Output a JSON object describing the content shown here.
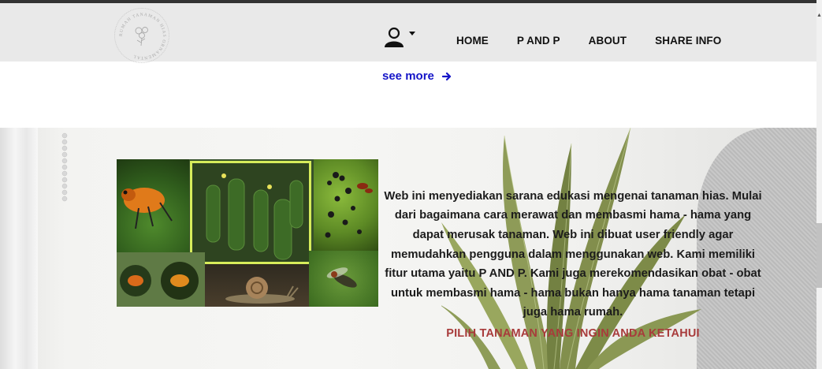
{
  "header": {
    "logo_text": "RUMAH TANAMAN HIAS ORNAMENTAL",
    "nav": [
      {
        "label": "HOME"
      },
      {
        "label": "P AND P"
      },
      {
        "label": "ABOUT"
      },
      {
        "label": "SHARE INFO"
      }
    ],
    "user_icon": "user-icon",
    "dropdown_icon": "caret-down-icon"
  },
  "see_more": {
    "label": "see more",
    "icon": "arrow-right-icon"
  },
  "about": {
    "description": "Web ini menyediakan sarana edukasi mengenai tanaman hias. Mulai dari bagaimana cara merawat dan membasmi hama - hama yang dapat merusak tanaman. Web ini dibuat user friendly agar memudahkan pengguna dalam menggunakan web. Kami memiliki fitur utama yaitu P AND P. Kami juga merekomendasikan obat - obat untuk membasmi hama - hama bukan hanya hama tanaman tetapi juga hama rumah.",
    "cta": "PILIH TANAMAN YANG INGIN ANDA KETAHUI"
  },
  "colors": {
    "link": "#1515c8",
    "cta": "#a83b3b",
    "header_bg": "#e9e9e9",
    "collage_border": "#d7ec5b"
  }
}
